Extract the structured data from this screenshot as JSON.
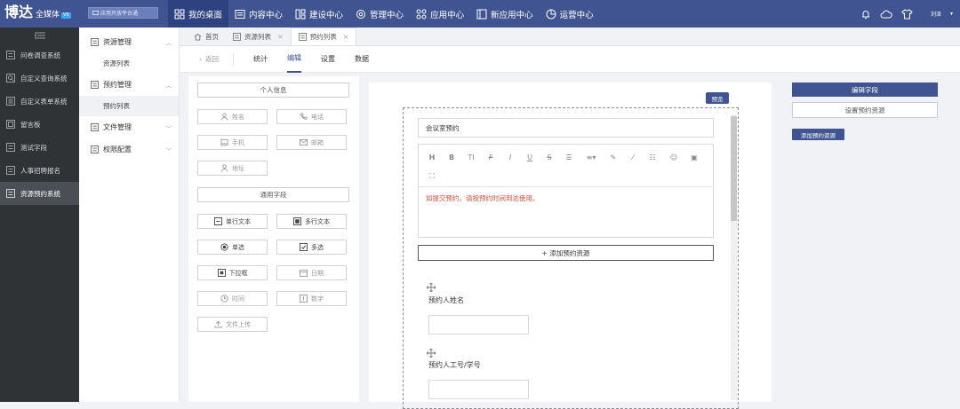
{
  "brand": {
    "logo": "博达",
    "sub": "全媒体",
    "badge": "V5"
  },
  "platform_selector": {
    "label": "应用开放平台通"
  },
  "nav": [
    {
      "label": "我的桌面",
      "icon": "grid-icon",
      "active": true
    },
    {
      "label": "内容中心",
      "icon": "document-icon"
    },
    {
      "label": "建设中心",
      "icon": "layout-icon"
    },
    {
      "label": "管理中心",
      "icon": "gear-icon"
    },
    {
      "label": "应用中心",
      "icon": "apps-icon"
    },
    {
      "label": "新应用中心",
      "icon": "window-icon"
    },
    {
      "label": "运营中心",
      "icon": "chart-pie-icon"
    }
  ],
  "top_right": {
    "user": "刘泽"
  },
  "sidebar": {
    "items": [
      {
        "label": "问卷调查系统"
      },
      {
        "label": "自定义查询系统"
      },
      {
        "label": "自定义表单系统"
      },
      {
        "label": "留言板"
      },
      {
        "label": "测试字段"
      },
      {
        "label": "人事招聘报名"
      },
      {
        "label": "资源预约系统",
        "active": true
      }
    ]
  },
  "subnav": {
    "groups": [
      {
        "label": "资源管理",
        "children": [
          "资源列表"
        ]
      },
      {
        "label": "预约管理",
        "children": [
          "预约列表"
        ]
      },
      {
        "label": "文件管理",
        "children": []
      },
      {
        "label": "权限配置",
        "children": []
      }
    ]
  },
  "tabs": [
    {
      "label": "首页"
    },
    {
      "label": "资源列表"
    },
    {
      "label": "预约列表",
      "active": true
    }
  ],
  "subtabs": {
    "back": "返回",
    "items": [
      "统计",
      "编辑",
      "设置",
      "数据"
    ],
    "active": "编辑"
  },
  "left_panel": {
    "personal_section": "个人信息",
    "personal_fields": [
      "姓名",
      "电话",
      "手机",
      "邮箱",
      "地址"
    ],
    "common_section": "通用字段",
    "common_fields": [
      "单行文本",
      "多行文本",
      "单选",
      "多选",
      "下拉框",
      "日期",
      "时间",
      "数字",
      "文件上传"
    ]
  },
  "canvas": {
    "preview": "预览",
    "title_value": "会议室预约",
    "editor_text": "如提交预约，请按预约时间到达使用。",
    "add_resource": "+ 添加预约资源",
    "field1_label": "预约人姓名",
    "field2_label": "预约人工号/学号"
  },
  "right_panel": {
    "edit_field": "编辑字段",
    "set_resource": "设置预约资源",
    "add_resource": "添加预约资源"
  },
  "colors": {
    "primary": "#3f5490",
    "sidebar": "#2f3336",
    "editor_text": "#d14b3e"
  }
}
